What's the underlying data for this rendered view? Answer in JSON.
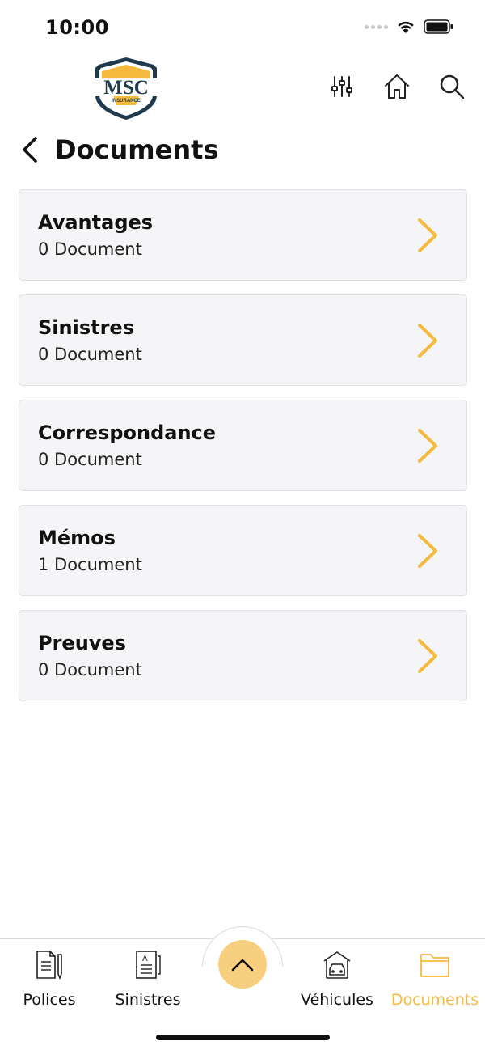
{
  "status_bar": {
    "time": "10:00"
  },
  "header": {
    "logo_text": "MSC",
    "logo_subtext": "INSURANCE",
    "actions": [
      "filter-icon",
      "home-icon",
      "search-icon"
    ]
  },
  "page": {
    "title": "Documents"
  },
  "documents": [
    {
      "title": "Avantages",
      "count": "0 Document"
    },
    {
      "title": "Sinistres",
      "count": "0 Document"
    },
    {
      "title": "Correspondance",
      "count": "0 Document"
    },
    {
      "title": "Mémos",
      "count": "1 Document"
    },
    {
      "title": "Preuves",
      "count": "0 Document"
    }
  ],
  "tabs": [
    {
      "label": "Polices",
      "icon": "policy-document-icon"
    },
    {
      "label": "Sinistres",
      "icon": "claim-document-icon"
    },
    {
      "label": "Véhicules",
      "icon": "car-garage-icon"
    },
    {
      "label": "Documents",
      "icon": "folder-icon",
      "active": true
    }
  ],
  "colors": {
    "accent": "#f5b93f",
    "accent_light": "#f8cf7f",
    "card_bg": "#f5f5f7",
    "logo_navy": "#1e3a4c"
  }
}
